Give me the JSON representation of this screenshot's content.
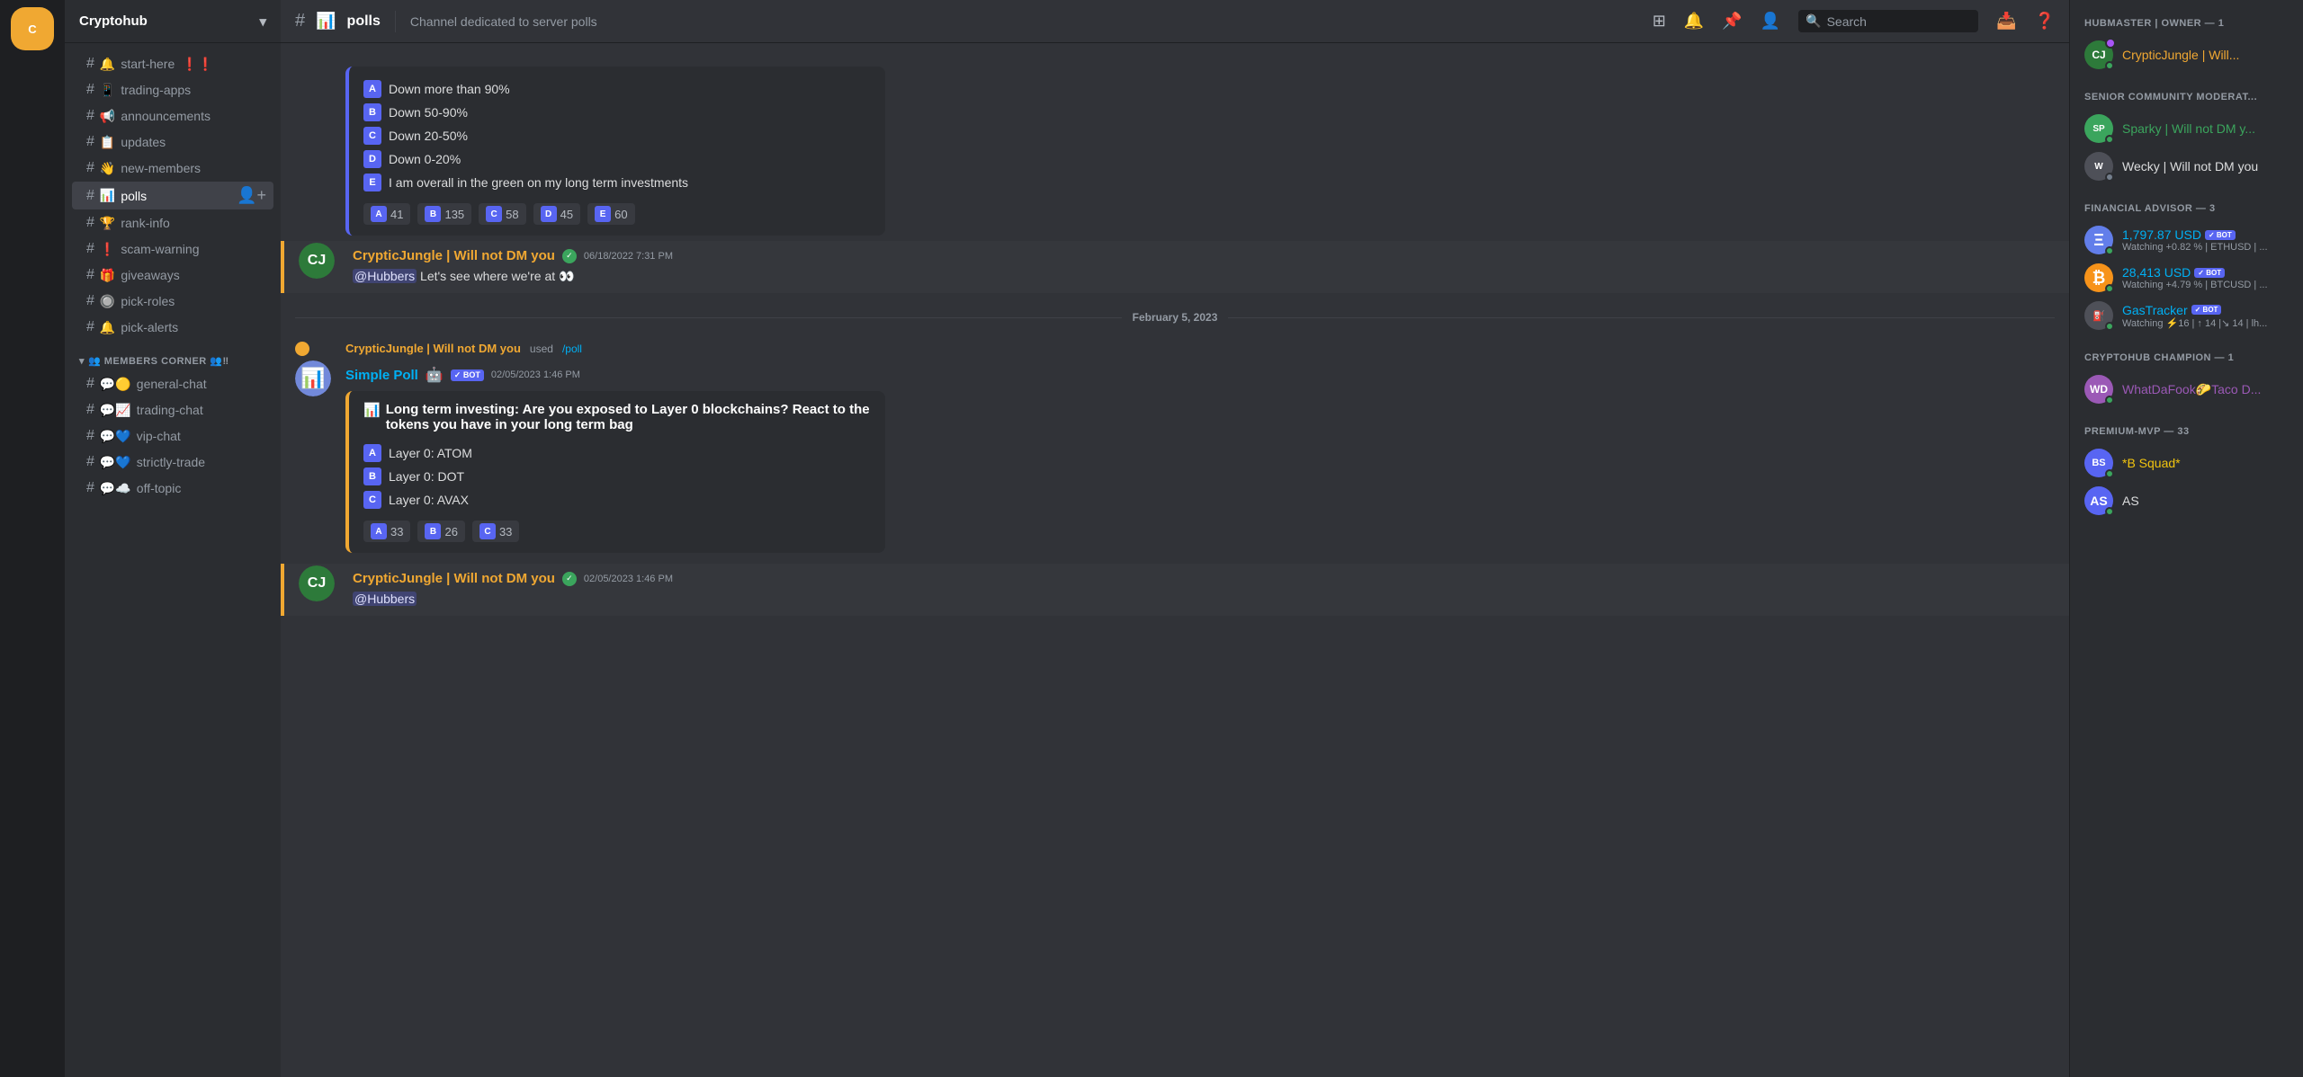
{
  "app": {
    "title": "Cryptohub"
  },
  "server": {
    "name": "Cryptohub",
    "dropdown_icon": "▾"
  },
  "channels": {
    "text_channels": [
      {
        "id": "start-here",
        "name": "start-here",
        "emoji": "🔔",
        "suffix": "❗❗"
      },
      {
        "id": "trading-apps",
        "name": "trading-apps",
        "emoji": "📱"
      },
      {
        "id": "announcements",
        "name": "announcements",
        "emoji": "📢"
      },
      {
        "id": "updates",
        "name": "updates",
        "emoji": "📋"
      },
      {
        "id": "new-members",
        "name": "new-members",
        "emoji": "👋"
      },
      {
        "id": "polls",
        "name": "polls",
        "emoji": "📊",
        "active": true
      },
      {
        "id": "rank-info",
        "name": "rank-info",
        "emoji": "🏆"
      },
      {
        "id": "scam-warning",
        "name": "scam-warning",
        "emoji": "❗"
      },
      {
        "id": "giveaways",
        "name": "giveaways",
        "emoji": "🎁"
      },
      {
        "id": "pick-roles",
        "name": "pick-roles",
        "emoji": "🔘"
      },
      {
        "id": "pick-alerts",
        "name": "pick-alerts",
        "emoji": "🔔"
      }
    ],
    "members_corner": [
      {
        "id": "general-chat",
        "name": "general-chat",
        "emoji": "💬🟡"
      },
      {
        "id": "trading-chat",
        "name": "trading-chat",
        "emoji": "💬📈"
      },
      {
        "id": "vip-chat",
        "name": "vip-chat",
        "emoji": "💬💙"
      },
      {
        "id": "strictly-trade",
        "name": "strictly-trade",
        "emoji": "💬💙"
      },
      {
        "id": "off-topic",
        "name": "off-topic",
        "emoji": "💬☁️"
      }
    ]
  },
  "current_channel": {
    "name": "polls",
    "description": "Channel dedicated to server polls"
  },
  "topbar": {
    "search_placeholder": "Search",
    "icons": [
      "threads-icon",
      "notifications-icon",
      "pin-icon",
      "members-icon"
    ]
  },
  "poll1": {
    "options": [
      {
        "letter": "A",
        "text": "Down more than 90%"
      },
      {
        "letter": "B",
        "text": "Down 50-90%"
      },
      {
        "letter": "C",
        "text": "Down 20-50%"
      },
      {
        "letter": "D",
        "text": "Down 0-20%"
      },
      {
        "letter": "E",
        "text": "I am overall in the green on my long term investments"
      }
    ],
    "votes": [
      {
        "letter": "A",
        "count": "41"
      },
      {
        "letter": "B",
        "count": "135"
      },
      {
        "letter": "C",
        "count": "58"
      },
      {
        "letter": "D",
        "count": "45"
      },
      {
        "letter": "E",
        "count": "60"
      }
    ]
  },
  "message1": {
    "author": "CrypticJungle | Will not DM you",
    "timestamp": "06/18/2022 7:31 PM",
    "content": "@Hubbers Let's see where we're at 👀"
  },
  "date_sep": "February 5, 2023",
  "used_command": {
    "user": "CrypticJungle | Will not DM you",
    "command": "/poll",
    "text": "used"
  },
  "poll2": {
    "bot_name": "Simple Poll",
    "timestamp": "02/05/2023 1:46 PM",
    "title": "Long term investing: Are you exposed to Layer 0 blockchains? React to the tokens you have in your long term bag",
    "options": [
      {
        "letter": "A",
        "text": "Layer 0: ATOM"
      },
      {
        "letter": "B",
        "text": "Layer 0: DOT"
      },
      {
        "letter": "C",
        "text": "Layer 0: AVAX"
      }
    ],
    "votes": [
      {
        "letter": "A",
        "count": "33"
      },
      {
        "letter": "B",
        "count": "26"
      },
      {
        "letter": "C",
        "count": "33"
      }
    ]
  },
  "message2": {
    "author": "CrypticJungle | Will not DM you",
    "timestamp": "02/05/2023 1:46 PM",
    "content": "@Hubbers"
  },
  "right_sidebar": {
    "categories": [
      {
        "name": "HUBMASTER | OWNER — 1",
        "members": [
          {
            "name": "CrypticJungle | Will...",
            "status": "online",
            "color": "owner-color",
            "has_purple_dot": true
          }
        ]
      },
      {
        "name": "SENIOR COMMUNITY MODERAT...",
        "members": [
          {
            "name": "Sparky | Will not DM y...",
            "status": "online",
            "color": "mod-color"
          },
          {
            "name": "Wecky | Will not DM you",
            "status": "offline",
            "color": ""
          }
        ]
      },
      {
        "name": "FINANCIAL ADVISOR — 3",
        "members": [
          {
            "name": "1,797.87 USD",
            "subtext": "Watching +0.82 % | ETHUSD | ...",
            "status": "online",
            "color": "advisor-color",
            "is_bot": true,
            "bot_label": "BOT"
          },
          {
            "name": "28,413 USD",
            "subtext": "Watching +4.79 % | BTCUSD | ...",
            "status": "online",
            "color": "advisor-color",
            "is_bot": true,
            "bot_label": "BOT"
          },
          {
            "name": "GasTracker",
            "subtext": "Watching ⚡16 | ↑ 14 |↘ 14 | lh...",
            "status": "online",
            "color": "advisor-color",
            "is_bot": true,
            "bot_label": "BOT"
          }
        ]
      },
      {
        "name": "CRYPTOHUB CHAMPION — 1",
        "members": [
          {
            "name": "WhatDaFook🌮Taco D...",
            "status": "online",
            "color": "champion-color"
          }
        ]
      },
      {
        "name": "PREMIUM-MVP — 33",
        "members": [
          {
            "name": "*B Squad*",
            "status": "online",
            "color": "premium-color"
          },
          {
            "name": "AS",
            "status": "online",
            "color": ""
          }
        ]
      }
    ]
  }
}
